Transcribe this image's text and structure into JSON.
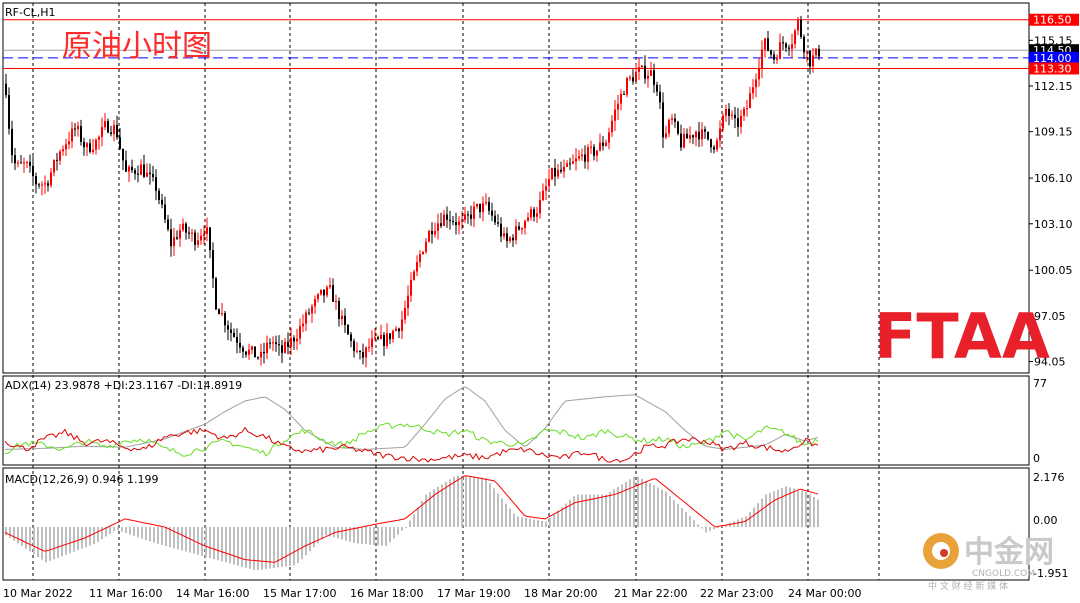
{
  "header": {
    "symbol": "RF-CL,H1",
    "title_cn": "原油小时图"
  },
  "price_axis": {
    "ticks": [
      "115.15",
      "112.15",
      "109.15",
      "106.10",
      "103.10",
      "100.05",
      "97.05",
      "94.05"
    ],
    "levels": [
      {
        "value": 116.5,
        "label": "116.50",
        "line_color": "#ff0000",
        "badge_color": "#ff0000",
        "style": "solid"
      },
      {
        "value": 114.5,
        "label": "114.50",
        "line_color": "#a0a0a0",
        "badge_color": "#000000",
        "style": "solid"
      },
      {
        "value": 114.0,
        "label": "114.00",
        "line_color": "#0000ff",
        "badge_color": "#0000ff",
        "style": "dashed"
      },
      {
        "value": 113.3,
        "label": "113.30",
        "line_color": "#ff0000",
        "badge_color": "#ff0000",
        "style": "solid"
      }
    ]
  },
  "time_axis": {
    "labels": [
      "10 Mar 2022",
      "11 Mar 16:00",
      "14 Mar 16:00",
      "15 Mar 17:00",
      "16 Mar 18:00",
      "17 Mar 19:00",
      "18 Mar 20:00",
      "21 Mar 22:00",
      "22 Mar 23:00",
      "24 Mar 00:00"
    ]
  },
  "adx_panel": {
    "label": "ADX(14) 23.9878 +DI:23.1167 -DI:14.8919",
    "axis_max": "77",
    "axis_min": "0"
  },
  "macd_panel": {
    "label": "MACD(12,26,9) 0.946 1.199",
    "axis_top": "2.176",
    "axis_zero": "0.00",
    "axis_bottom": "-1.951"
  },
  "watermarks": {
    "ftaa": "FTAA",
    "cngold_cn": "中金网",
    "cngold_en": "CNGOLD.COM",
    "cngold_slogan": "中 文 财 经 新 媒 体"
  },
  "colors": {
    "bull": "#ff0000",
    "bear": "#000000",
    "adx": "#a0a0a0",
    "plus_di": "#66dd22",
    "minus_di": "#dd0000",
    "macd_hist": "#bfbfbf",
    "macd_signal": "#ff0000"
  },
  "chart_data": [
    {
      "type": "candlestick",
      "title": "原油小时图",
      "symbol": "RF-CL,H1",
      "ylim": [
        93.3,
        117.6
      ],
      "x_labels": [
        "10 Mar 2022",
        "11 Mar 16:00",
        "14 Mar 16:00",
        "15 Mar 17:00",
        "16 Mar 18:00",
        "17 Mar 19:00",
        "18 Mar 20:00",
        "21 Mar 22:00",
        "22 Mar 23:00",
        "24 Mar 00:00"
      ],
      "close_path": [
        [
          0,
          112.0
        ],
        [
          5,
          108.0
        ],
        [
          10,
          106.8
        ],
        [
          20,
          107.0
        ],
        [
          30,
          105.8
        ],
        [
          40,
          105.7
        ],
        [
          55,
          108.0
        ],
        [
          70,
          109.4
        ],
        [
          80,
          108.0
        ],
        [
          92,
          108.6
        ],
        [
          100,
          109.6
        ],
        [
          110,
          109.3
        ],
        [
          120,
          106.4
        ],
        [
          135,
          106.8
        ],
        [
          150,
          105.5
        ],
        [
          165,
          101.8
        ],
        [
          175,
          102.8
        ],
        [
          190,
          102.1
        ],
        [
          200,
          103.0
        ],
        [
          210,
          97.9
        ],
        [
          225,
          96.0
        ],
        [
          240,
          94.8
        ],
        [
          255,
          94.3
        ],
        [
          265,
          95.5
        ],
        [
          275,
          94.6
        ],
        [
          290,
          95.8
        ],
        [
          305,
          97.5
        ],
        [
          315,
          98.4
        ],
        [
          325,
          98.7
        ],
        [
          335,
          96.8
        ],
        [
          345,
          95.3
        ],
        [
          355,
          94.2
        ],
        [
          365,
          95.2
        ],
        [
          380,
          95.5
        ],
        [
          395,
          96.6
        ],
        [
          405,
          99.0
        ],
        [
          415,
          101.3
        ],
        [
          425,
          102.8
        ],
        [
          440,
          103.7
        ],
        [
          455,
          103.0
        ],
        [
          470,
          104.1
        ],
        [
          480,
          104.2
        ],
        [
          490,
          103.2
        ],
        [
          500,
          101.8
        ],
        [
          510,
          102.6
        ],
        [
          520,
          103.5
        ],
        [
          532,
          104.1
        ],
        [
          545,
          106.3
        ],
        [
          560,
          106.6
        ],
        [
          575,
          107.5
        ],
        [
          590,
          107.9
        ],
        [
          600,
          108.6
        ],
        [
          610,
          110.7
        ],
        [
          620,
          112.3
        ],
        [
          632,
          113.1
        ],
        [
          645,
          113.0
        ],
        [
          652,
          112.0
        ],
        [
          658,
          108.5
        ],
        [
          665,
          110.0
        ],
        [
          675,
          108.4
        ],
        [
          690,
          109.2
        ],
        [
          700,
          108.8
        ],
        [
          710,
          108.2
        ],
        [
          720,
          110.6
        ],
        [
          730,
          109.5
        ],
        [
          740,
          110.5
        ],
        [
          750,
          113.0
        ],
        [
          758,
          115.0
        ],
        [
          768,
          114.0
        ],
        [
          776,
          115.0
        ],
        [
          785,
          115.0
        ],
        [
          792,
          116.3
        ],
        [
          798,
          114.8
        ],
        [
          804,
          113.8
        ],
        [
          810,
          114.2
        ],
        [
          815,
          114.5
        ]
      ],
      "reference_levels": [
        116.5,
        114.5,
        114.0,
        113.3
      ]
    },
    {
      "type": "line",
      "title": "ADX(14) 23.9878 +DI:23.1167 -DI:14.8919",
      "ylim": [
        0,
        77
      ],
      "series": [
        {
          "name": "ADX(14)",
          "points": [
            [
              0,
              12
            ],
            [
              40,
              13
            ],
            [
              80,
              15
            ],
            [
              120,
              14
            ],
            [
              160,
              22
            ],
            [
              200,
              36
            ],
            [
              220,
              48
            ],
            [
              240,
              58
            ],
            [
              260,
              62
            ],
            [
              280,
              50
            ],
            [
              300,
              30
            ],
            [
              330,
              14
            ],
            [
              360,
              12
            ],
            [
              400,
              14
            ],
            [
              420,
              36
            ],
            [
              440,
              60
            ],
            [
              460,
              72
            ],
            [
              480,
              58
            ],
            [
              500,
              30
            ],
            [
              520,
              14
            ],
            [
              540,
              32
            ],
            [
              560,
              58
            ],
            [
              600,
              62
            ],
            [
              630,
              64
            ],
            [
              660,
              48
            ],
            [
              680,
              30
            ],
            [
              700,
              15
            ],
            [
              720,
              12
            ],
            [
              760,
              16
            ],
            [
              780,
              26
            ],
            [
              800,
              20
            ],
            [
              815,
              23.9878
            ]
          ]
        },
        {
          "name": "+DI",
          "points": [
            [
              0,
              10
            ],
            [
              20,
              18
            ],
            [
              40,
              16
            ],
            [
              60,
              12
            ],
            [
              80,
              20
            ],
            [
              100,
              14
            ],
            [
              120,
              20
            ],
            [
              140,
              22
            ],
            [
              160,
              12
            ],
            [
              180,
              8
            ],
            [
              200,
              14
            ],
            [
              220,
              20
            ],
            [
              240,
              14
            ],
            [
              260,
              8
            ],
            [
              280,
              22
            ],
            [
              300,
              30
            ],
            [
              320,
              20
            ],
            [
              340,
              16
            ],
            [
              360,
              28
            ],
            [
              380,
              34
            ],
            [
              400,
              36
            ],
            [
              420,
              32
            ],
            [
              440,
              26
            ],
            [
              460,
              30
            ],
            [
              480,
              20
            ],
            [
              500,
              18
            ],
            [
              520,
              16
            ],
            [
              540,
              30
            ],
            [
              560,
              28
            ],
            [
              580,
              22
            ],
            [
              600,
              30
            ],
            [
              620,
              24
            ],
            [
              640,
              20
            ],
            [
              660,
              22
            ],
            [
              680,
              14
            ],
            [
              700,
              18
            ],
            [
              720,
              30
            ],
            [
              740,
              20
            ],
            [
              760,
              32
            ],
            [
              780,
              28
            ],
            [
              800,
              16
            ],
            [
              815,
              23.1167
            ]
          ]
        },
        {
          "name": "-DI",
          "points": [
            [
              0,
              20
            ],
            [
              20,
              12
            ],
            [
              40,
              22
            ],
            [
              60,
              28
            ],
            [
              80,
              18
            ],
            [
              100,
              20
            ],
            [
              120,
              14
            ],
            [
              140,
              12
            ],
            [
              160,
              24
            ],
            [
              180,
              28
            ],
            [
              200,
              30
            ],
            [
              220,
              22
            ],
            [
              240,
              30
            ],
            [
              260,
              24
            ],
            [
              280,
              14
            ],
            [
              300,
              10
            ],
            [
              320,
              12
            ],
            [
              340,
              14
            ],
            [
              360,
              10
            ],
            [
              380,
              6
            ],
            [
              400,
              4
            ],
            [
              420,
              2
            ],
            [
              440,
              4
            ],
            [
              460,
              6
            ],
            [
              480,
              4
            ],
            [
              500,
              10
            ],
            [
              520,
              12
            ],
            [
              540,
              6
            ],
            [
              560,
              4
            ],
            [
              580,
              10
            ],
            [
              600,
              2
            ],
            [
              620,
              2
            ],
            [
              640,
              14
            ],
            [
              660,
              16
            ],
            [
              680,
              22
            ],
            [
              700,
              20
            ],
            [
              720,
              12
            ],
            [
              740,
              18
            ],
            [
              760,
              14
            ],
            [
              780,
              10
            ],
            [
              800,
              20
            ],
            [
              815,
              14.8919
            ]
          ]
        }
      ]
    },
    {
      "type": "bar",
      "title": "MACD(12,26,9) 0.946 1.199",
      "ylim": [
        -1.951,
        2.176
      ],
      "hist_points": [
        [
          0,
          -0.3
        ],
        [
          40,
          -1.3
        ],
        [
          90,
          -0.6
        ],
        [
          110,
          -0.1
        ],
        [
          150,
          -0.6
        ],
        [
          200,
          -1.1
        ],
        [
          250,
          -1.6
        ],
        [
          290,
          -1.4
        ],
        [
          320,
          -0.3
        ],
        [
          350,
          -0.6
        ],
        [
          380,
          -0.7
        ],
        [
          400,
          0.0
        ],
        [
          420,
          1.2
        ],
        [
          450,
          1.9
        ],
        [
          480,
          1.8
        ],
        [
          510,
          0.4
        ],
        [
          540,
          0.2
        ],
        [
          570,
          1.2
        ],
        [
          600,
          1.2
        ],
        [
          630,
          1.9
        ],
        [
          660,
          1.3
        ],
        [
          700,
          -0.2
        ],
        [
          740,
          0.4
        ],
        [
          760,
          1.2
        ],
        [
          780,
          1.5
        ],
        [
          800,
          1.3
        ],
        [
          815,
          0.946
        ]
      ],
      "signal_points": [
        [
          0,
          -0.2
        ],
        [
          40,
          -0.9
        ],
        [
          80,
          -0.4
        ],
        [
          120,
          0.3
        ],
        [
          160,
          0.0
        ],
        [
          200,
          -0.7
        ],
        [
          240,
          -1.2
        ],
        [
          270,
          -1.3
        ],
        [
          300,
          -0.7
        ],
        [
          330,
          -0.2
        ],
        [
          370,
          0.1
        ],
        [
          400,
          0.3
        ],
        [
          430,
          1.2
        ],
        [
          460,
          1.9
        ],
        [
          490,
          1.7
        ],
        [
          520,
          0.4
        ],
        [
          540,
          0.3
        ],
        [
          570,
          0.9
        ],
        [
          610,
          1.2
        ],
        [
          650,
          1.8
        ],
        [
          680,
          0.9
        ],
        [
          710,
          0.0
        ],
        [
          740,
          0.2
        ],
        [
          770,
          1.0
        ],
        [
          795,
          1.4
        ],
        [
          815,
          1.199
        ]
      ]
    }
  ]
}
